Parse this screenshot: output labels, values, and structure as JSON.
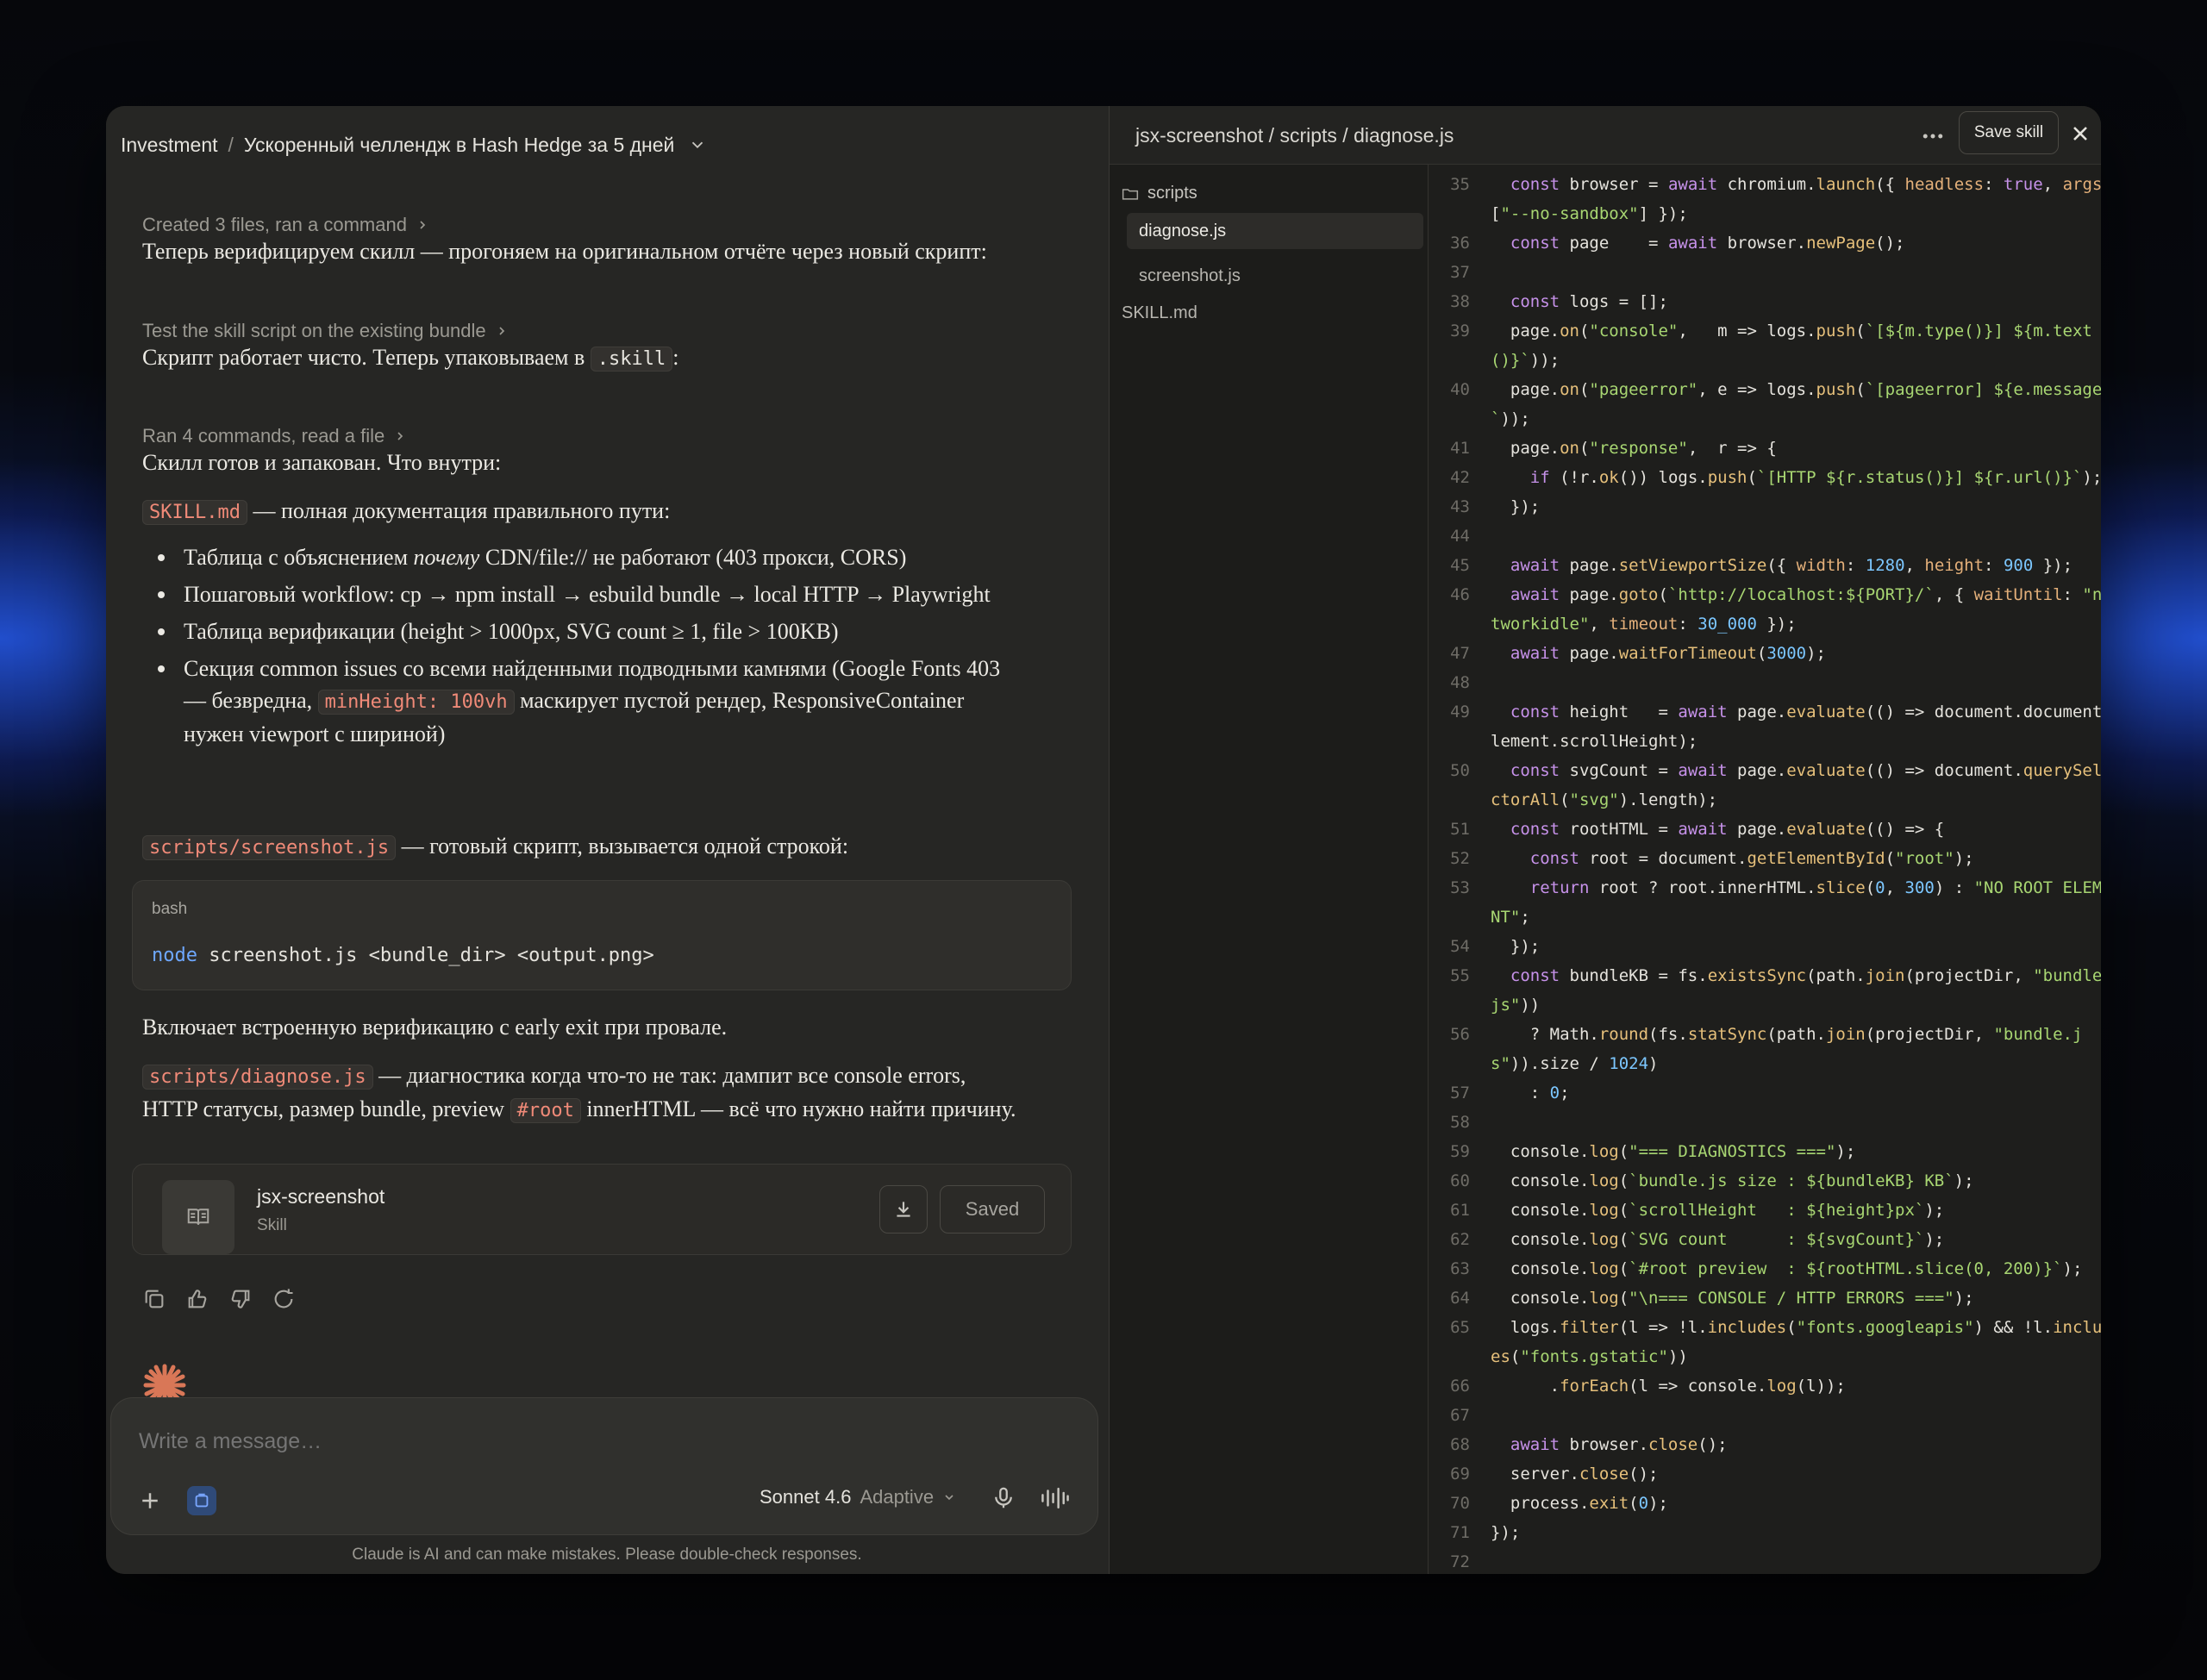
{
  "chat": {
    "breadcrumb": {
      "project": "Investment",
      "separator": "/",
      "conversation": "Ускоренный челлендж в Hash Hedge за 5 дней"
    },
    "steps": {
      "s1": "Created 3 files, ran a command",
      "s2": "Test the skill script on the existing bundle",
      "s3": "Ran 4 commands, read a file"
    },
    "messages": {
      "m1": "Теперь верифицируем скилл — прогоняем на оригинальном отчёте через новый скрипт:",
      "m2_pre": "Скрипт работает чисто. Теперь упаковываем в ",
      "m2_code": ".skill",
      "m2_post": ":",
      "m3": "Скилл готов и запакован. Что внутри:",
      "m4_code": "SKILL.md",
      "m4_text": " — полная документация правильного пути:",
      "b1_pre": "Таблица с объяснением ",
      "b1_em": "почему",
      "b1_post": " CDN/file:// не работают (403 прокси, CORS)",
      "b2": "Пошаговый workflow: cp → npm install → esbuild bundle → local HTTP → Playwright",
      "b3": "Таблица верификации (height > 1000px, SVG count ≥ 1, file > 100KB)",
      "b4_pre": "Секция common issues со всеми найденными подводными камнями (Google Fonts 403 — безвредна, ",
      "b4_code": "minHeight: 100vh",
      "b4_post": " маскирует пустой рендер, ResponsiveContainer нужен viewport с шириной)",
      "m5_code": "scripts/screenshot.js",
      "m5_text": " — готовый скрипт, вызывается одной строкой:",
      "m6": "Включает встроенную верификацию с early exit при провале.",
      "m7_code": "scripts/diagnose.js",
      "m7_text1": " — диагностика когда что-то не так: дампит все console errors, HTTP статусы, размер bundle, preview ",
      "m7_code2": "#root",
      "m7_text2": " innerHTML — всё что нужно найти причину."
    },
    "codeblock": {
      "lang": "bash",
      "cmd_kw": "node",
      "cmd_rest": " screenshot.js <bundle_dir> <output.png>"
    },
    "artifact": {
      "title": "jsx-screenshot",
      "subtitle": "Skill",
      "saved_label": "Saved"
    },
    "composer": {
      "placeholder": "Write a message…",
      "model": "Sonnet 4.6",
      "mode": "Adaptive"
    },
    "disclaimer": "Claude is AI and can make mistakes. Please double-check responses."
  },
  "files": {
    "path": "jsx-screenshot / scripts / diagnose.js",
    "save_label": "Save skill",
    "tree": {
      "folder": "scripts",
      "f1": "diagnose.js",
      "f2": "screenshot.js",
      "f3": "SKILL.md"
    },
    "line_numbers": [
      "35",
      "36",
      "37",
      "38",
      "39",
      "40",
      "41",
      "42",
      "43",
      "44",
      "45",
      "46",
      "47",
      "48",
      "49",
      "50",
      "51",
      "52",
      "53",
      "54",
      "55",
      "56",
      "57",
      "58",
      "59",
      "60",
      "61",
      "62",
      "63",
      "64",
      "65",
      "66",
      "67",
      "68",
      "69",
      "70",
      "71",
      "72"
    ]
  },
  "colors": {
    "accent": "#d97757",
    "inline_code": "#f08a78",
    "keyword": "#c792ea",
    "string": "#a8d672",
    "number": "#7cc7ff"
  },
  "icons": [
    "chevron-down-icon",
    "chevron-right-icon",
    "book-icon",
    "download-icon",
    "copy-icon",
    "thumbs-up-icon",
    "thumbs-down-icon",
    "retry-icon",
    "spark-icon",
    "plus-icon",
    "project-icon",
    "mic-icon",
    "voice-wave-icon",
    "more-icon",
    "close-icon",
    "folder-icon"
  ]
}
